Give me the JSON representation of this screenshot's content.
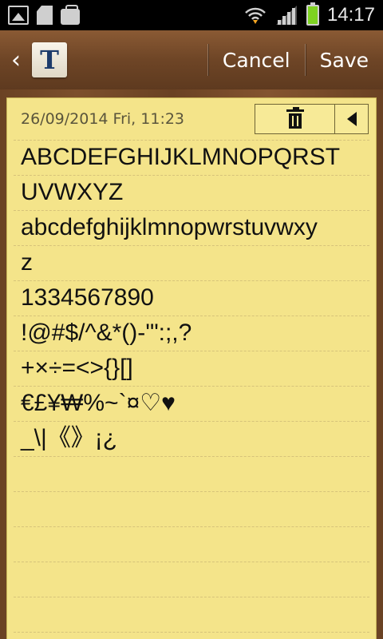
{
  "status_bar": {
    "time": "14:17",
    "icons": [
      "gallery-icon",
      "sd-card-icon",
      "shopping-bag-icon",
      "wifi-icon",
      "signal-icon",
      "battery-icon"
    ]
  },
  "action_bar": {
    "back_icon": "chevron-left-icon",
    "app_icon_letter": "T",
    "cancel_label": "Cancel",
    "save_label": "Save"
  },
  "note": {
    "date": "26/09/2014 Fri, 11:23",
    "delete_icon": "trash-icon",
    "previous_icon": "triangle-left-icon",
    "lines": [
      "ABCDEFGHIJKLMNOPQRST",
      "UVWXYZ",
      "abcdefghijklmnopwrstuvwxy",
      "z",
      "1334567890",
      "!@#$/^&*()-'\":;,?",
      "+×÷=<>{}[]",
      "€£¥₩%~`¤♡♥",
      "_\\|《》¡¿"
    ]
  },
  "colors": {
    "paper": "#f4e48a",
    "wood": "#6e4526",
    "text": "#111111"
  }
}
